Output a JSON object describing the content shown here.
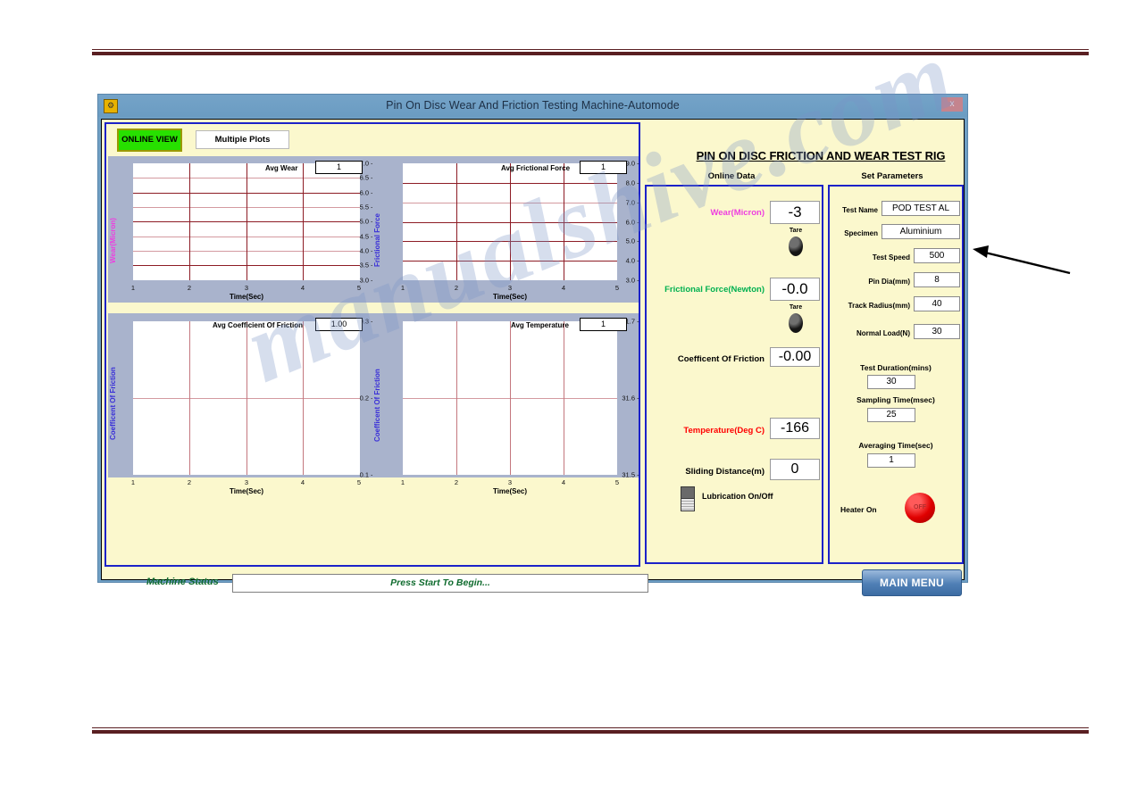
{
  "window": {
    "title": "Pin On Disc Wear And Friction Testing Machine-Automode",
    "close_label": "x",
    "app_icon": "app-icon"
  },
  "toolbar": {
    "online_view_label": "ONLINE VIEW",
    "multiple_plots_label": "Multiple Plots"
  },
  "header": {
    "title": "PIN ON DISC FRICTION AND WEAR TEST RIG",
    "online_data_label": "Online Data",
    "set_parameters_label": "Set Parameters"
  },
  "chart_data": [
    {
      "id": "avg-wear",
      "type": "line",
      "title": "Avg Wear",
      "legend_value": "1",
      "xlabel": "Time(Sec)",
      "ylabel": "Wear(Micron)",
      "ylabel_color": "#ee3fe0",
      "xticks": [
        "1",
        "2",
        "3",
        "4",
        "5"
      ],
      "yticks": [
        "7.0",
        "6.5",
        "6.0",
        "5.5",
        "5.0",
        "4.5",
        "4.0",
        "3.5",
        "3.0"
      ],
      "ymajor": [
        "7.0",
        "6.0",
        "5.0",
        "3.5"
      ],
      "ylim": [
        3.0,
        7.0
      ],
      "xlim": [
        1,
        5
      ],
      "grid": true,
      "series": [
        {
          "name": "Avg Wear",
          "x": [],
          "values": []
        }
      ]
    },
    {
      "id": "avg-frictional-force",
      "type": "line",
      "title": "Avg Frictional Force",
      "legend_value": "1",
      "xlabel": "Time(Sec)",
      "ylabel": "Frictional Force",
      "ylabel_color": "#3a30d8",
      "xticks": [
        "1",
        "2",
        "3",
        "4",
        "5"
      ],
      "yticks": [
        "9.0",
        "8.0",
        "7.0",
        "6.0",
        "5.0",
        "4.0",
        "3.0"
      ],
      "ymajor": [
        "9.0",
        "8.0",
        "6.0",
        "5.0",
        "4.0"
      ],
      "ylim": [
        3.0,
        9.0
      ],
      "xlim": [
        1,
        5
      ],
      "grid": true,
      "series": [
        {
          "name": "Avg Frictional Force",
          "x": [],
          "values": []
        }
      ]
    },
    {
      "id": "avg-coefficient-of-friction",
      "type": "line",
      "title": "Avg Coefficient Of Friction",
      "legend_value": "1.00",
      "xlabel": "Time(Sec)",
      "ylabel": "Coefficent Of Friction",
      "ylabel_color": "#3a30d8",
      "xticks": [
        "1",
        "2",
        "3",
        "4",
        "5"
      ],
      "yticks": [
        "0.3",
        "0.2",
        "0.1"
      ],
      "ymajor": [
        "0.3",
        "0.2"
      ],
      "ylim": [
        0.1,
        0.3
      ],
      "xlim": [
        1,
        5
      ],
      "grid": true,
      "series": [
        {
          "name": "Avg Coefficient Of Friction",
          "x": [],
          "values": []
        }
      ]
    },
    {
      "id": "avg-temperature",
      "type": "line",
      "title": "Avg Temperature",
      "legend_value": "1",
      "xlabel": "Time(Sec)",
      "ylabel": "Coefficent Of Friction",
      "ylabel_color": "#3a30d8",
      "xticks": [
        "1",
        "2",
        "3",
        "4",
        "5"
      ],
      "yticks": [
        "31.7",
        "31.6",
        "31.5"
      ],
      "ymajor": [
        "31.7",
        "31.6"
      ],
      "ylim": [
        31.5,
        31.7
      ],
      "xlim": [
        1,
        5
      ],
      "grid": true,
      "series": [
        {
          "name": "Avg Temperature",
          "x": [],
          "values": []
        }
      ]
    }
  ],
  "online_data": {
    "wear": {
      "label": "Wear(Micron)",
      "value": "-3",
      "color": "#ee3fe0",
      "tare_label": "Tare"
    },
    "frictional_force": {
      "label": "Frictional Force(Newton)",
      "value": "-0.0",
      "color": "#00b050",
      "tare_label": "Tare"
    },
    "coefficient_of_friction": {
      "label": "Coefficent Of Friction",
      "value": "-0.00",
      "color": "#000000"
    },
    "temperature": {
      "label": "Temperature(Deg C)",
      "value": "-166",
      "color": "#ff0000"
    },
    "sliding_distance": {
      "label": "Sliding Distance(m)",
      "value": "0",
      "color": "#000000"
    },
    "lubrication": {
      "label": "Lubrication On/Off"
    }
  },
  "set_parameters": {
    "test_name": {
      "label": "Test Name",
      "value": "POD TEST AL"
    },
    "specimen": {
      "label": "Specimen",
      "value": "Aluminium"
    },
    "test_speed": {
      "label": "Test Speed",
      "value": "500"
    },
    "pin_dia": {
      "label": "Pin Dia(mm)",
      "value": "8"
    },
    "track_radius": {
      "label": "Track Radius(mm)",
      "value": "40"
    },
    "normal_load": {
      "label": "Normal Load(N)",
      "value": "30"
    },
    "test_duration": {
      "label": "Test Duration(mins)",
      "value": "30"
    },
    "sampling_time": {
      "label": "Sampling Time(msec)",
      "value": "25"
    },
    "averaging_time": {
      "label": "Averaging Time(sec)",
      "value": "1"
    },
    "heater": {
      "label": "Heater On",
      "state": "OFF"
    }
  },
  "status_bar": {
    "label": "Machine Status",
    "message": "Press Start To Begin...",
    "main_menu_label": "MAIN MENU"
  },
  "watermark": {
    "text": "manualshive.com"
  },
  "colors": {
    "accent_blue": "#1c22c8",
    "panel_yellow": "#fbf8cd",
    "chart_bg": "#a9b3cc",
    "grid_major": "#8d1c25",
    "grid_minor": "#d49aa0",
    "rule": "#5a1f22"
  }
}
